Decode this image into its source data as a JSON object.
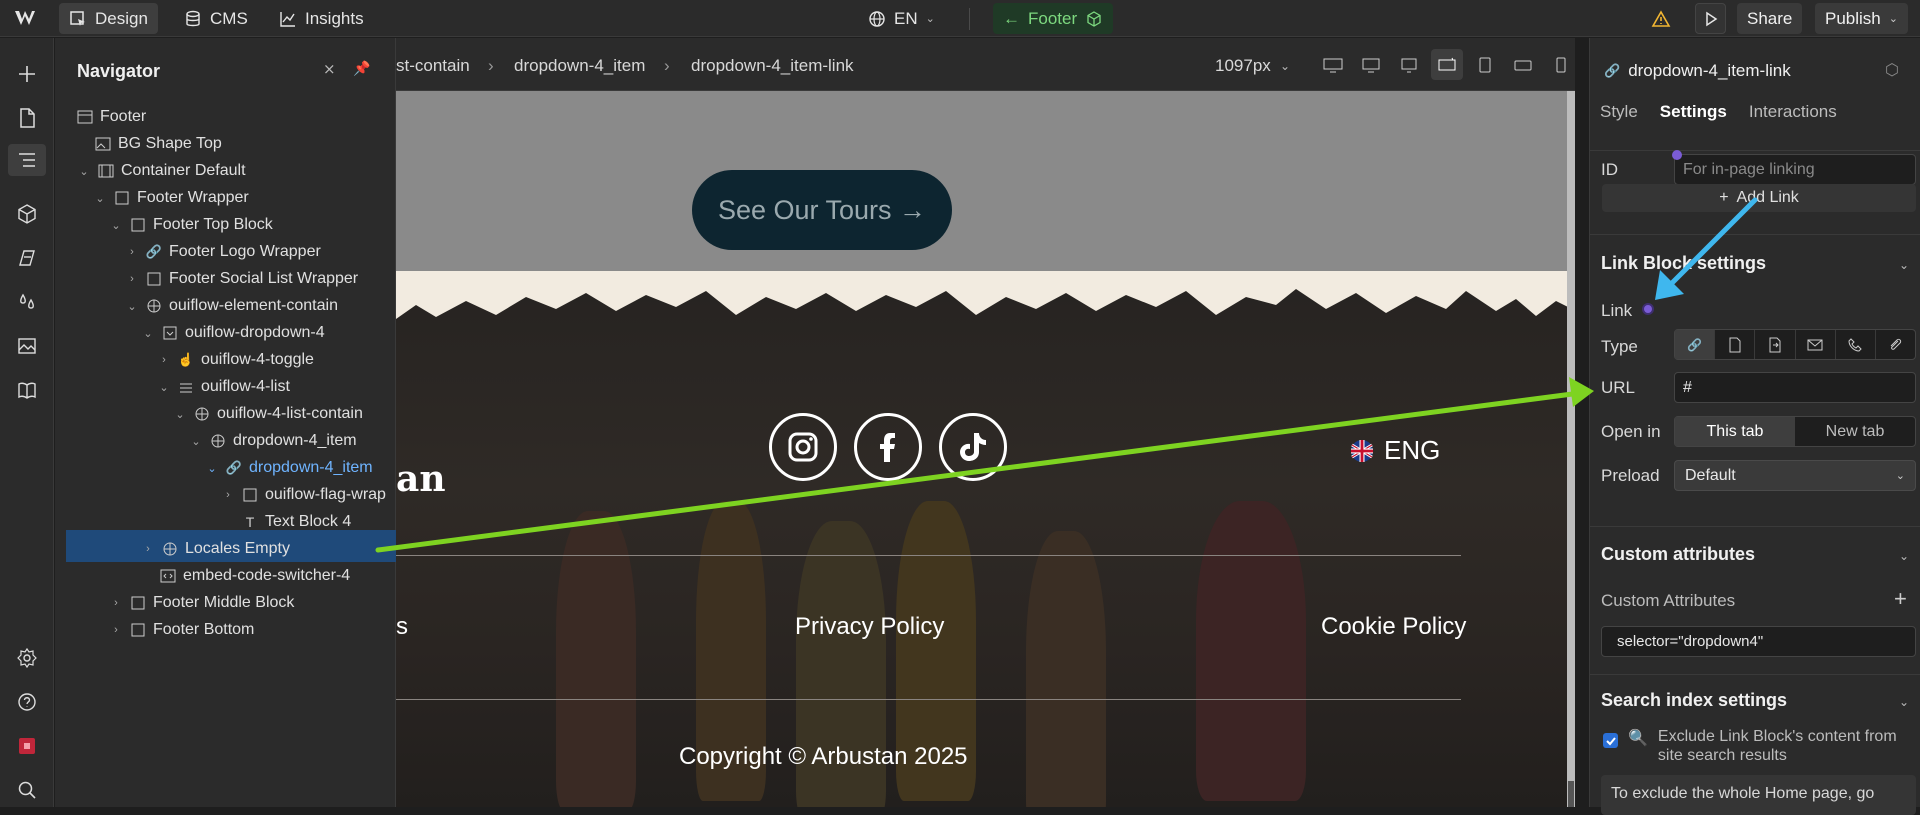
{
  "topbar": {
    "design": "Design",
    "cms": "CMS",
    "insights": "Insights",
    "locale": "EN",
    "component": "Footer",
    "share": "Share",
    "publish": "Publish"
  },
  "navigator": {
    "title": "Navigator",
    "items": [
      {
        "label": "Footer"
      },
      {
        "label": "BG Shape Top"
      },
      {
        "label": "Container Default"
      },
      {
        "label": "Footer Wrapper"
      },
      {
        "label": "Footer Top Block"
      },
      {
        "label": "Footer Logo Wrapper"
      },
      {
        "label": "Footer Social List Wrapper"
      },
      {
        "label": "ouiflow-element-contain"
      },
      {
        "label": "ouiflow-dropdown-4"
      },
      {
        "label": "ouiflow-4-toggle"
      },
      {
        "label": "ouiflow-4-list"
      },
      {
        "label": "ouiflow-4-list-contain"
      },
      {
        "label": "dropdown-4_item"
      },
      {
        "label": "dropdown-4_item"
      },
      {
        "label": "ouiflow-flag-wrap"
      },
      {
        "label": "Text Block 4"
      },
      {
        "label": "Locales Empty"
      },
      {
        "label": "embed-code-switcher-4"
      },
      {
        "label": "Footer Middle Block"
      },
      {
        "label": "Footer Bottom"
      }
    ]
  },
  "breadcrumbs": [
    "st-contain",
    "dropdown-4_item",
    "dropdown-4_item-link"
  ],
  "viewport": "1097px",
  "site": {
    "tours_button": "See Our Tours →",
    "logo_fragment": "an",
    "lang": "ENG",
    "links": [
      "s",
      "Privacy Policy",
      "Cookie Policy"
    ],
    "copyright": "Copyright © Arbustan 2025"
  },
  "panel": {
    "title": "dropdown-4_item-link",
    "tabs": [
      "Style",
      "Settings",
      "Interactions"
    ],
    "id_label": "ID",
    "id_placeholder": "For in-page linking",
    "add_link": "Add Link",
    "link_block_title": "Link Block settings",
    "link_label": "Link",
    "type_label": "Type",
    "url_label": "URL",
    "url_value": "#",
    "open_in_label": "Open in",
    "open_this": "This tab",
    "open_new": "New tab",
    "preload_label": "Preload",
    "preload_value": "Default",
    "custom_attr_title": "Custom attributes",
    "custom_attr_label": "Custom Attributes",
    "custom_attr_value": "selector=\"dropdown4\"",
    "search_title": "Search index settings",
    "exclude_text": "Exclude Link Block's content from site search results",
    "info_text": "To exclude the whole Home page, go"
  },
  "colors": {
    "accent_green": "#7ed321",
    "accent_blue": "#3fb7ee",
    "selection": "#1f4a7a"
  }
}
